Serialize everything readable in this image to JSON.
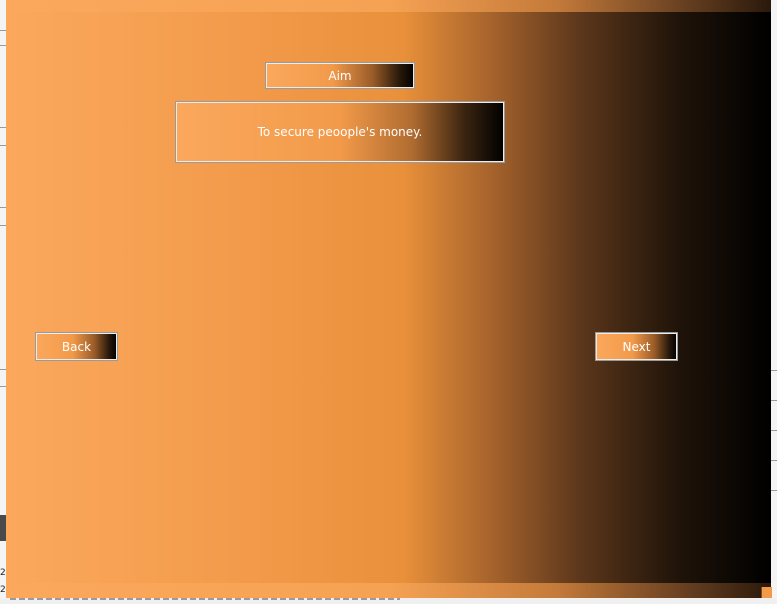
{
  "header": {
    "title": "Aim"
  },
  "content": {
    "aim_text": "To secure peoople's money."
  },
  "navigation": {
    "back_label": "Back",
    "next_label": "Next"
  },
  "background_window": {
    "left_digits": [
      "2",
      "2"
    ]
  },
  "colors": {
    "gradient_start": "#fba85d",
    "gradient_mid": "#e8903a",
    "gradient_end": "#000000",
    "text": "#ffffff",
    "widget_border": "#9a9a9a"
  }
}
